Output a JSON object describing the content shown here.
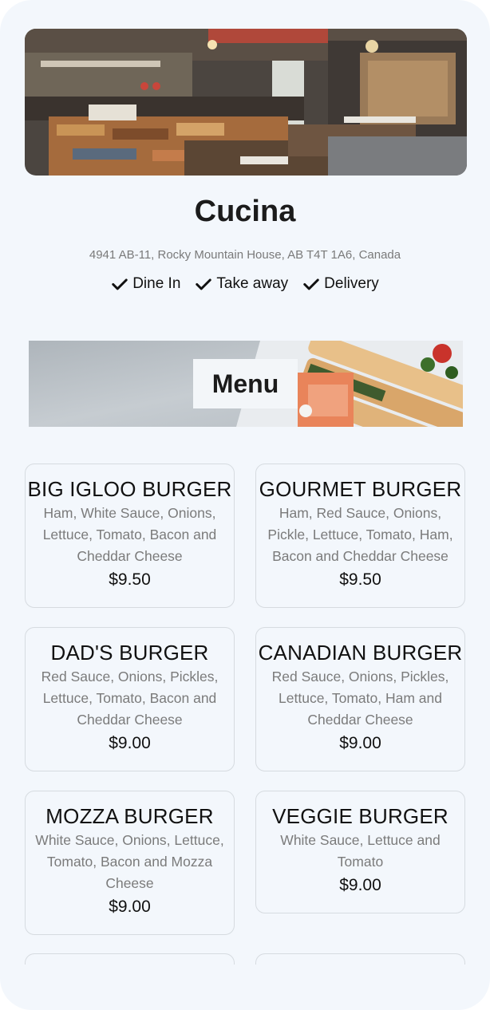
{
  "restaurant": {
    "name": "Cucina",
    "address": "4941 AB-11, Rocky Mountain House, AB T4T 1A6, Canada",
    "services": [
      "Dine In",
      "Take away",
      "Delivery"
    ]
  },
  "menu": {
    "heading": "Menu",
    "items": [
      {
        "name": "BIG IGLOO BURGER",
        "desc": "Ham, White Sauce, Onions, Lettuce, Tomato, Bacon and Cheddar Cheese",
        "price": "$9.50"
      },
      {
        "name": "GOURMET BURGER",
        "desc": "Ham, Red Sauce, Onions, Pickle, Lettuce, Tomato, Ham, Bacon and Cheddar Cheese",
        "price": "$9.50"
      },
      {
        "name": "DAD'S BURGER",
        "desc": "Red Sauce, Onions, Pickles, Lettuce, Tomato, Bacon and Cheddar Cheese",
        "price": "$9.00"
      },
      {
        "name": "CANADIAN BURGER",
        "desc": "Red Sauce, Onions, Pickles, Lettuce, Tomato, Ham and Cheddar Cheese",
        "price": "$9.00"
      },
      {
        "name": "MOZZA BURGER",
        "desc": "White Sauce, Onions, Lettuce, Tomato, Bacon and Mozza Cheese",
        "price": "$9.00"
      },
      {
        "name": "VEGGIE BURGER",
        "desc": "White Sauce, Lettuce and Tomato",
        "price": "$9.00"
      }
    ]
  },
  "icons": {
    "service": "check-icon"
  }
}
